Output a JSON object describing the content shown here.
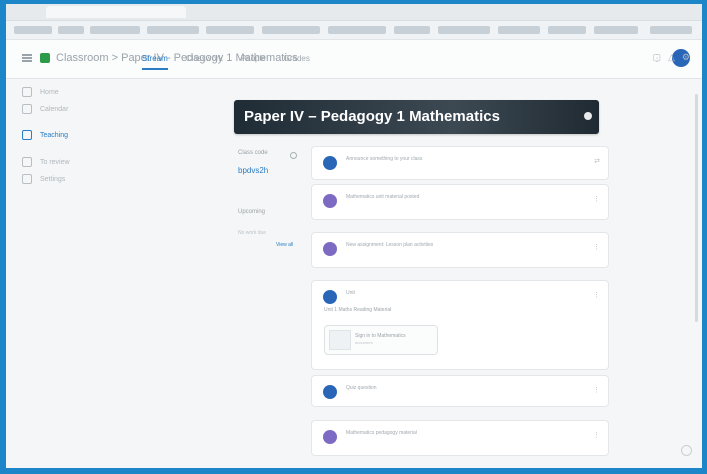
{
  "app": {
    "header_title": "Classroom > Paper IV - Pedagogy 1 Mathematics",
    "nav_tabs": [
      "Stream",
      "Classwork",
      "People",
      "Grades"
    ],
    "sidebar_items": [
      "Home",
      "Calendar",
      "Teaching",
      "To review",
      "Settings"
    ]
  },
  "banner": {
    "title": "Paper IV – Pedagogy 1 Mathematics"
  },
  "left_panel": {
    "code_label": "Class code",
    "code_value": "bpdvs2h",
    "upcoming_label": "Upcoming",
    "upcoming_sub": "No work due",
    "view_all": "View all"
  },
  "feed": {
    "posts": [
      {
        "text": "Announce something to your class",
        "sub": "",
        "color": "#2a66b8"
      },
      {
        "text": "Mathematics unit material posted",
        "sub": "",
        "color": "#7d6ac2"
      },
      {
        "text": "New assignment: Lesson plan activities",
        "sub": "",
        "color": "#7d6ac2"
      },
      {
        "text": "Unit",
        "sub": "",
        "color": "#2a66b8"
      },
      {
        "text": "Quiz question",
        "sub": "",
        "color": "#2a66b8"
      },
      {
        "text": "Mathematics pedagogy material",
        "sub": "",
        "color": "#7d6ac2"
      }
    ],
    "announcement_text": "Unit 1 Maths Reading Material",
    "attachment_title": "Sign in to Mathematics",
    "attachment_sub": "document"
  },
  "colors": {
    "accent": "#2a7cc4",
    "banner": "#2f3b45"
  }
}
